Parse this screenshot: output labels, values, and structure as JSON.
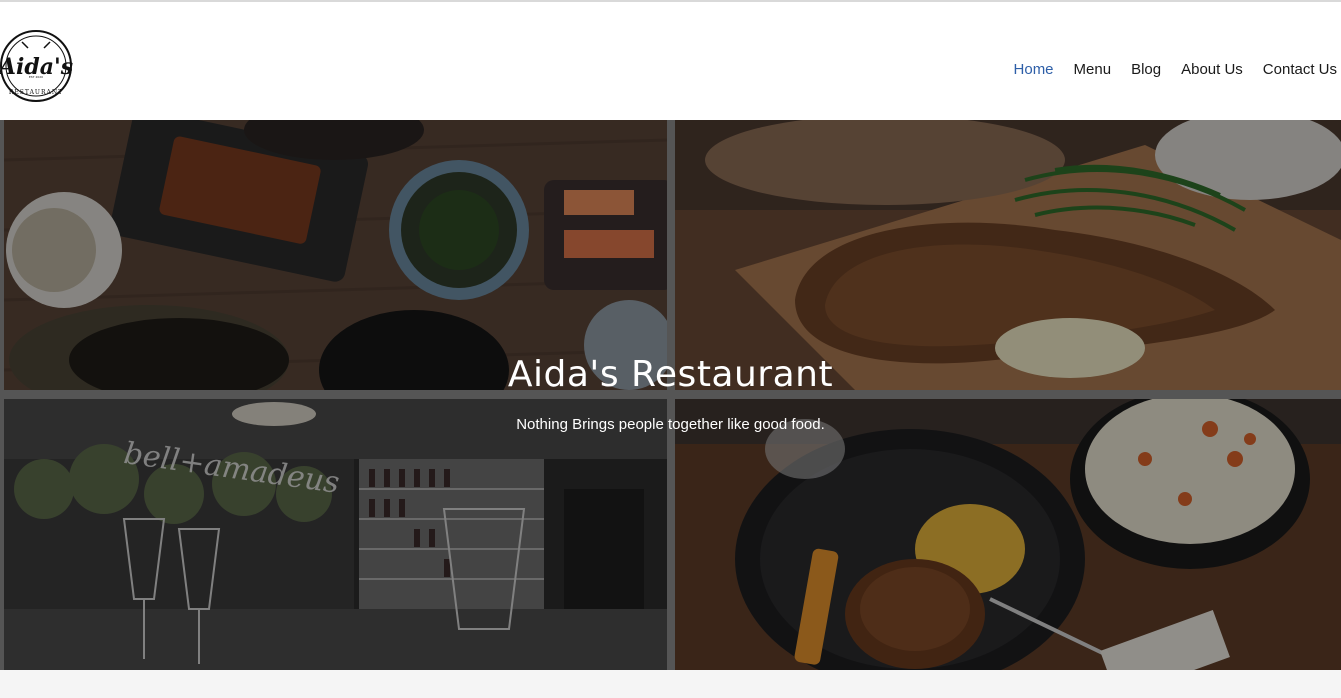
{
  "brand": {
    "logo_text": "Aida's",
    "logo_subtext": "RESTAURANT",
    "logo_est": "EST 2020"
  },
  "nav": {
    "items": [
      {
        "label": "Home",
        "active": true
      },
      {
        "label": "Menu",
        "active": false
      },
      {
        "label": "Blog",
        "active": false
      },
      {
        "label": "About Us",
        "active": false
      },
      {
        "label": "Contact Us",
        "active": false
      }
    ],
    "active_color": "#2e5fa8"
  },
  "hero": {
    "title": "Aida's Restaurant",
    "subtitle": "Nothing Brings people together like good food.",
    "images": [
      {
        "name": "overhead-dishes-photo"
      },
      {
        "name": "grilled-pork-chop-photo"
      },
      {
        "name": "restaurant-interior-photo",
        "sign_text": "bell+amadeus"
      },
      {
        "name": "plated-entree-photo"
      }
    ]
  }
}
